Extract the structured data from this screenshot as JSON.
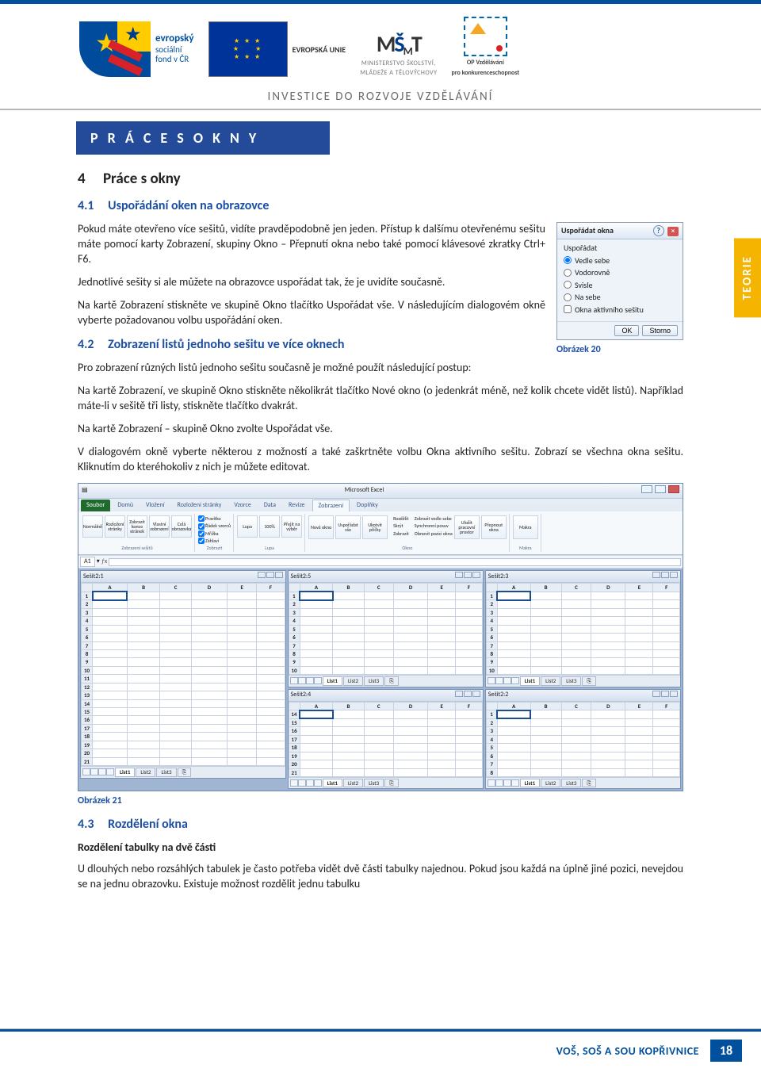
{
  "header": {
    "esf_text1": "evropský",
    "esf_text2": "sociální",
    "esf_text3": "fond v ČR",
    "eu_label": "EVROPSKÁ UNIE",
    "msmt_line1": "MINISTERSTVO ŠKOLSTVÍ,",
    "msmt_line2": "MLÁDEŽE A TĚLOVÝCHOVY",
    "opvk_line1": "OP Vzdělávání",
    "opvk_line2": "pro konkurenceschopnost",
    "invest": "INVESTICE DO ROZVOJE VZDĚLÁVÁNÍ"
  },
  "side_tab": "TEORIE",
  "band": "P R Á C E   S   O K N Y",
  "h3": {
    "num": "4",
    "title": "Práce s okny"
  },
  "s41": {
    "num": "4.1",
    "title": "Uspořádání oken na obrazovce"
  },
  "s42": {
    "num": "4.2",
    "title": "Zobrazení listů jednoho sešitu ve více oknech"
  },
  "s43": {
    "num": "4.3",
    "title": "Rozdělení okna"
  },
  "p1": "Pokud máte otevřeno více sešitů, vidíte pravděpodobně jen jeden. Přístup k dalšímu otevřenému sešitu máte pomocí karty Zobrazení, skupiny Okno – Přepnutí okna nebo také pomocí klávesové zkratky Ctrl+ F6.",
  "p2": "Jednotlivé sešity si ale můžete na obrazovce uspořádat tak, že je uvidíte současně.",
  "p3": "Na kartě Zobrazení stiskněte ve skupině Okno tlačítko Uspořádat vše. V následujícím dialogovém okně vyberte požadovanou volbu uspořádání oken.",
  "p4": "Pro zobrazení různých listů jednoho sešitu současně je možné použít následující postup:",
  "p5": "Na kartě Zobrazení, ve skupině Okno stiskněte několikrát tlačítko Nové okno (o jedenkrát méně, než kolik chcete vidět listů). Například máte-li v sešitě tři listy, stiskněte tlačítko dvakrát.",
  "p6": "Na kartě Zobrazení – skupině Okno zvolte Uspořádat vše.",
  "p7": "V dialogovém okně vyberte některou z možností a také zaškrtněte volbu Okna aktivního sešitu. Zobrazí se všechna okna sešitu. Kliknutím do kteréhokoliv z nich je můžete editovat.",
  "cap20": "Obrázek 20",
  "cap21": "Obrázek 21",
  "bold_sub": "Rozdělení tabulky na dvě části",
  "p8": "U dlouhých nebo rozsáhlých tabulek je často potřeba vidět dvě části tabulky najednou. Pokud jsou každá na úplně jiné pozici, nevejdou se na jednu obrazovku. Existuje možnost rozdělit jednu tabulku",
  "dialog": {
    "title": "Uspořádat okna",
    "group": "Uspořádat",
    "opt1": "Vedle sebe",
    "opt2": "Vodorovně",
    "opt3": "Svisle",
    "opt4": "Na sebe",
    "chk": "Okna aktivního sešitu",
    "ok": "OK",
    "cancel": "Storno"
  },
  "excel": {
    "app_title": "Microsoft Excel",
    "tabs": [
      "Soubor",
      "Domů",
      "Vložení",
      "Rozložení stránky",
      "Vzorce",
      "Data",
      "Revize",
      "Zobrazení",
      "Doplňky"
    ],
    "active_tab": 7,
    "group_zs": "Zobrazení sešitů",
    "group_zobr": "Zobrazit",
    "group_lupa": "Lupa",
    "group_okno": "Okno",
    "group_makra": "Makra",
    "zs_icons": [
      "Normálně",
      "Rozložení stránky",
      "Zobrazit konce stránek",
      "Vlastní zobrazení",
      "Celá obrazovka"
    ],
    "zobr_checks": [
      "Pravítko",
      "Řádek vzorců",
      "Mřížka",
      "Záhlaví"
    ],
    "lupa_icons": [
      "Lupa",
      "100%",
      "Přejít na výběr"
    ],
    "okno_icons": [
      "Nové okno",
      "Uspořádat vše",
      "Ukotvit příčky"
    ],
    "okno_lines": [
      "Rozdělit",
      "Skrýt",
      "Zobrazit"
    ],
    "okno_lines2": [
      "Zobrazit vedle sebe",
      "Synchronní posuv",
      "Obnovit pozici okna"
    ],
    "okno_extra": [
      "Uložit pracovní prostor",
      "Přepnout okna"
    ],
    "makra": "Makra",
    "cellref": "A1",
    "sheets": {
      "s1": "Sešit2:1",
      "s2": "Sešit2:5",
      "s3": "Sešit2:3",
      "s4": "Sešit2:4",
      "s5": "Sešit2:2"
    },
    "cols": [
      "A",
      "B",
      "C",
      "D",
      "E",
      "F"
    ],
    "sheet_tabs": [
      "List1",
      "List2",
      "List3"
    ]
  },
  "footer": {
    "school": "VOŠ, SOŠ A SOU KOPŘIVNICE",
    "page": "18"
  }
}
